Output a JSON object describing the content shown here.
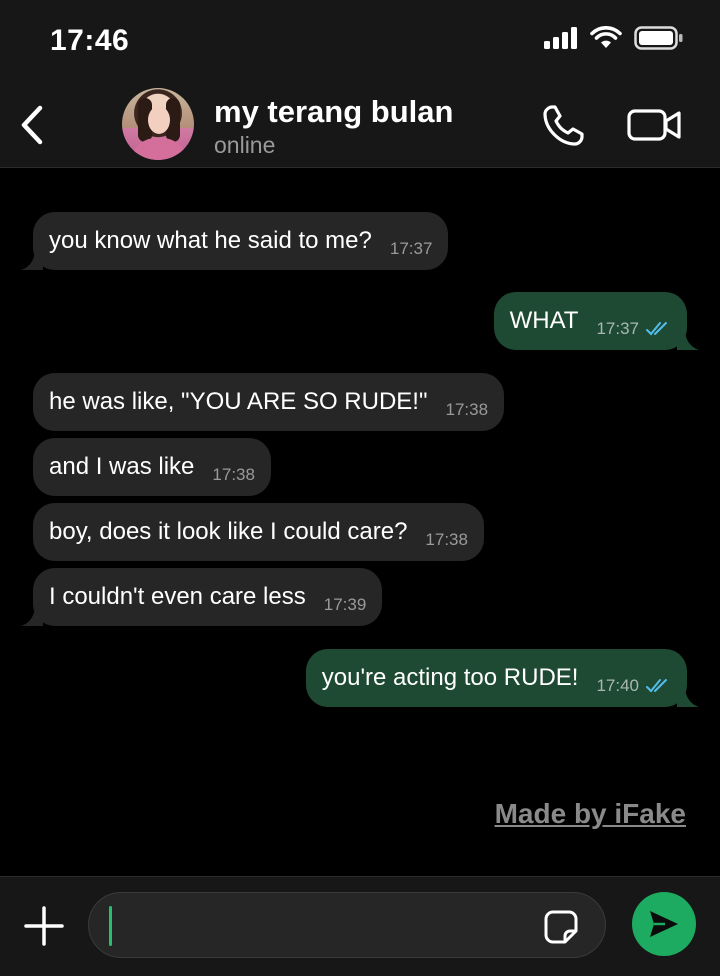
{
  "status_bar": {
    "time": "17:46"
  },
  "header": {
    "contact_name": "my terang bulan",
    "contact_status": "online"
  },
  "messages": [
    {
      "direction": "incoming",
      "text": "you know what he said to me?",
      "time": "17:37"
    },
    {
      "direction": "outgoing",
      "text": "WHAT",
      "time": "17:37",
      "read": true
    },
    {
      "direction": "incoming",
      "text": "he was like, \"YOU ARE SO RUDE!\"",
      "time": "17:38"
    },
    {
      "direction": "incoming",
      "text": "and I was like",
      "time": "17:38"
    },
    {
      "direction": "incoming",
      "text": "boy, does it look like I could care?",
      "time": "17:38"
    },
    {
      "direction": "incoming",
      "text": "I couldn't even care less",
      "time": "17:39"
    },
    {
      "direction": "outgoing",
      "text": "you're acting too RUDE!",
      "time": "17:40",
      "read": true
    }
  ],
  "watermark": "Made by iFake",
  "composer": {
    "value": ""
  },
  "colors": {
    "incoming_bubble": "#262626",
    "outgoing_bubble": "#1e4a33",
    "read_ticks": "#53bdeb",
    "send_button": "#1daa61"
  },
  "icons": [
    "signal-icon",
    "wifi-icon",
    "battery-icon",
    "back-chevron-icon",
    "phone-icon",
    "video-camera-icon",
    "plus-icon",
    "sticker-icon",
    "send-icon"
  ]
}
